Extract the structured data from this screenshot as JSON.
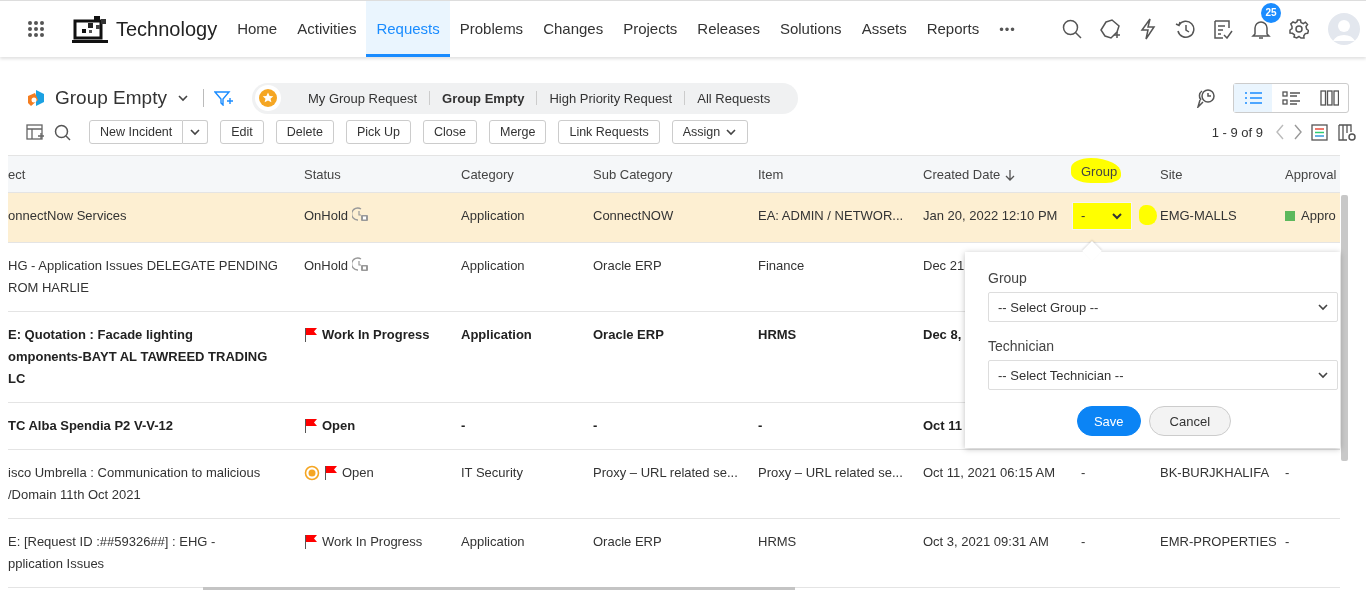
{
  "app": {
    "name": "Technology"
  },
  "nav": [
    {
      "label": "Home",
      "selected": false
    },
    {
      "label": "Activities",
      "selected": false
    },
    {
      "label": "Requests",
      "selected": true
    },
    {
      "label": "Problems",
      "selected": false
    },
    {
      "label": "Changes",
      "selected": false
    },
    {
      "label": "Projects",
      "selected": false
    },
    {
      "label": "Releases",
      "selected": false
    },
    {
      "label": "Solutions",
      "selected": false
    },
    {
      "label": "Assets",
      "selected": false
    },
    {
      "label": "Reports",
      "selected": false
    }
  ],
  "nav_more": "•••",
  "notifications": {
    "count": "25"
  },
  "view": {
    "title": "Group Empty",
    "filters": [
      {
        "label": "My Group Request",
        "selected": false
      },
      {
        "label": "Group Empty",
        "selected": true
      },
      {
        "label": "High Priority Request",
        "selected": false
      },
      {
        "label": "All Requests",
        "selected": false
      }
    ],
    "modes": [
      {
        "kind": "list",
        "selected": true
      },
      {
        "kind": "cards",
        "selected": false
      },
      {
        "kind": "columns",
        "selected": false
      }
    ]
  },
  "toolbar": {
    "buttons": [
      {
        "label": "New Incident",
        "kind": "split"
      },
      {
        "label": "Edit",
        "kind": "plain"
      },
      {
        "label": "Delete",
        "kind": "plain"
      },
      {
        "label": "Pick Up",
        "kind": "plain"
      },
      {
        "label": "Close",
        "kind": "plain"
      },
      {
        "label": "Merge",
        "kind": "plain"
      },
      {
        "label": "Link Requests",
        "kind": "plain"
      },
      {
        "label": "Assign",
        "kind": "menu"
      }
    ],
    "pagination": "1 - 9 of 9"
  },
  "table": {
    "columns": [
      {
        "label": "ect",
        "sorted": false,
        "highlighted": false
      },
      {
        "label": "Status",
        "sorted": false,
        "highlighted": false
      },
      {
        "label": "Category",
        "sorted": false,
        "highlighted": false
      },
      {
        "label": "Sub Category",
        "sorted": false,
        "highlighted": false
      },
      {
        "label": "Item",
        "sorted": false,
        "highlighted": false
      },
      {
        "label": "Created Date",
        "sorted": true,
        "highlighted": false
      },
      {
        "label": "Group",
        "sorted": false,
        "highlighted": true
      },
      {
        "label": "Site",
        "sorted": false,
        "highlighted": false
      },
      {
        "label": "Approval",
        "sorted": false,
        "highlighted": false
      }
    ],
    "rows": [
      {
        "selected": true,
        "unread": false,
        "subject": [
          "onnectNow Services"
        ],
        "status": {
          "label": "OnHold",
          "kind": "onhold",
          "overdue": false
        },
        "category": "Application",
        "sub_category": "ConnectNOW",
        "item": "EA: ADMIN / NETWOR...",
        "created": "Jan 20, 2022 12:10 PM",
        "group": {
          "value": "-",
          "kind": "dropdown",
          "highlighted": true
        },
        "site": "EMG-MALLS",
        "approval": {
          "label": "Appro",
          "color": "#5cb85c"
        }
      },
      {
        "selected": false,
        "unread": false,
        "subject": [
          "HG - Application Issues DELEGATE PENDING",
          "ROM HARLIE"
        ],
        "status": {
          "label": "OnHold",
          "kind": "onhold",
          "overdue": false
        },
        "category": "Application",
        "sub_category": "Oracle ERP",
        "item": "Finance",
        "created": "Dec 21"
      },
      {
        "selected": false,
        "unread": true,
        "subject": [
          "E: Quotation : Facade lighting",
          "omponents-BAYT AL TAWREED TRADING",
          "LC"
        ],
        "status": {
          "label": "Work In Progress",
          "kind": "flag",
          "overdue": false
        },
        "category": "Application",
        "sub_category": "Oracle ERP",
        "item": "HRMS",
        "created": "Dec 8,"
      },
      {
        "selected": false,
        "unread": true,
        "subject": [
          "TC Alba Spendia P2 V-V-12"
        ],
        "status": {
          "label": "Open",
          "kind": "flag",
          "overdue": false
        },
        "category": "-",
        "sub_category": "-",
        "item": "-",
        "created": "Oct 11"
      },
      {
        "selected": false,
        "unread": false,
        "subject": [
          "isco Umbrella : Communication to malicious",
          "/Domain 11th Oct 2021"
        ],
        "status": {
          "label": "Open",
          "kind": "flag",
          "overdue": true
        },
        "category": "IT Security",
        "sub_category": "Proxy – URL related se...",
        "item": "Proxy – URL related se...",
        "created": "Oct 11, 2021 06:15 AM",
        "group": {
          "value": "-",
          "kind": "text",
          "highlighted": false
        },
        "site": "BK-BURJKHALIFA",
        "approval": {
          "label": "-"
        }
      },
      {
        "selected": false,
        "unread": false,
        "subject": [
          "E: [Request ID :##59326##] : EHG -",
          "pplication Issues"
        ],
        "status": {
          "label": "Work In Progress",
          "kind": "flag",
          "overdue": false
        },
        "category": "Application",
        "sub_category": "Oracle ERP",
        "item": "HRMS",
        "created": "Oct 3, 2021 09:31 AM",
        "group": {
          "value": "-",
          "kind": "text",
          "highlighted": false
        },
        "site": "EMR-PROPERTIES",
        "approval": {
          "label": "-"
        }
      }
    ]
  },
  "assign_popup": {
    "fields": [
      {
        "label": "Group",
        "placeholder": "-- Select Group --"
      },
      {
        "label": "Technician",
        "placeholder": "-- Select Technician --"
      }
    ],
    "buttons": [
      {
        "label": "Save",
        "primary": true
      },
      {
        "label": "Cancel",
        "primary": false
      }
    ]
  }
}
